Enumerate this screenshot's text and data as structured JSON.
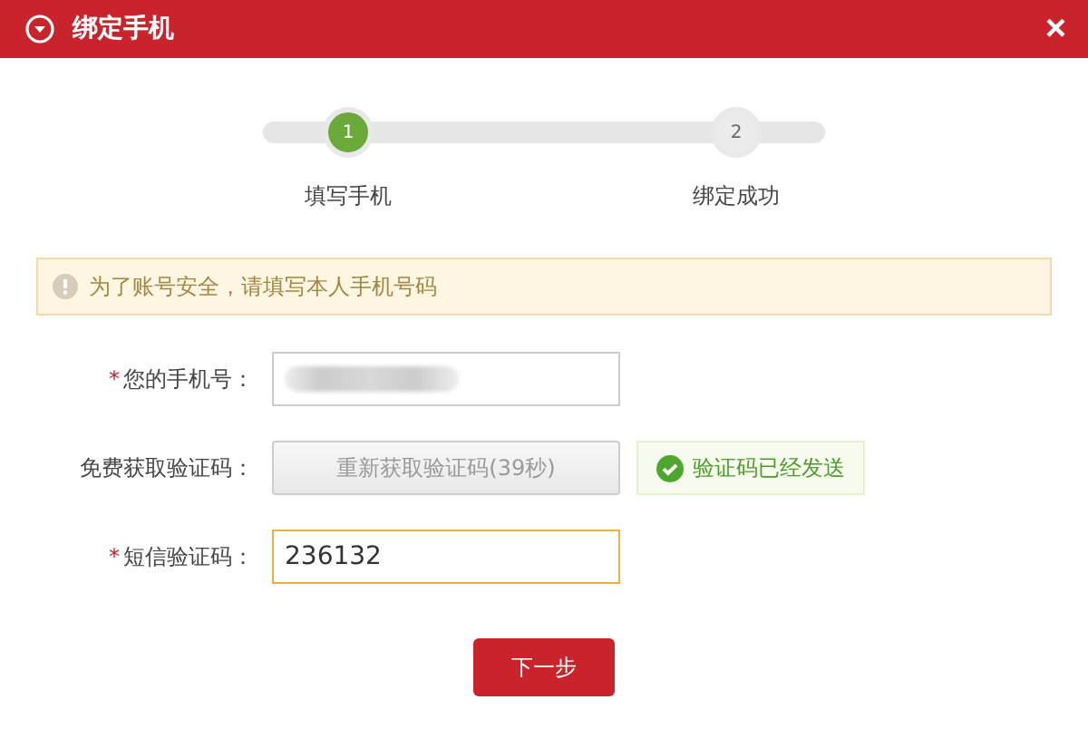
{
  "window": {
    "title": "绑定手机",
    "close_label": "×"
  },
  "steps": [
    {
      "number": "1",
      "label": "填写手机",
      "selected": true
    },
    {
      "number": "2",
      "label": "绑定成功",
      "selected": false
    }
  ],
  "notice": {
    "text": "为了账号安全，请填写本人手机号码"
  },
  "form": [
    {
      "kind": "masked",
      "label": "您的手机号：",
      "required_mark": "*"
    },
    {
      "kind": "button",
      "label": "免费获取验证码：",
      "button_label": "重新获取验证码(39秒)",
      "disabled": true,
      "status": "验证码已经发送"
    },
    {
      "kind": "input",
      "label": "短信验证码：",
      "required_mark": "*",
      "value": "236132",
      "focused": true
    }
  ],
  "submit": {
    "label": "下一步"
  }
}
